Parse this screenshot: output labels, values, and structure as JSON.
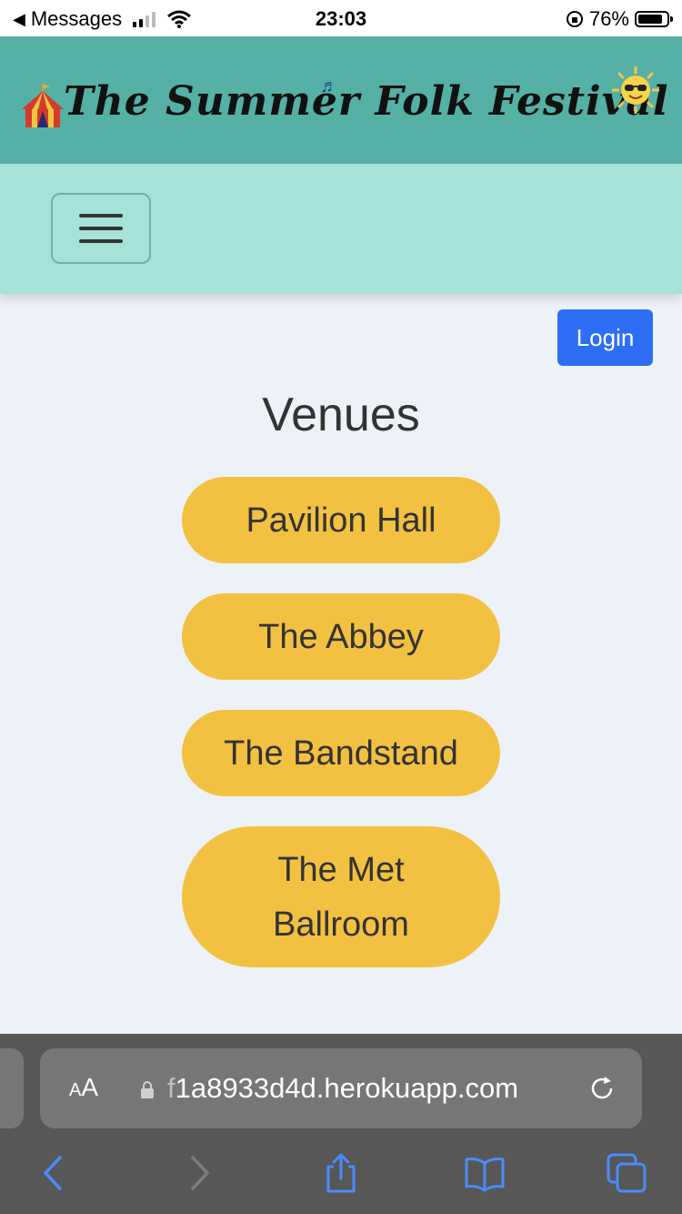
{
  "status_bar": {
    "back_label": "Messages",
    "time": "23:03",
    "battery_percent": "76%",
    "battery_level": 0.76
  },
  "header": {
    "title": "The Summer Folk Festival",
    "icons": [
      "circus-tent-icon",
      "music-note-icon",
      "sun-with-sunglasses-icon"
    ],
    "background_color": "#55b0a6"
  },
  "nav": {
    "menu_icon": "hamburger-menu-icon",
    "background_color": "#a6e2da"
  },
  "auth": {
    "login_label": "Login",
    "login_color": "#2d6ef5"
  },
  "main": {
    "heading": "Venues",
    "venues": [
      {
        "label": "Pavilion Hall"
      },
      {
        "label": "The Abbey"
      },
      {
        "label": "The Bandstand"
      },
      {
        "label": "The Met Ballroom"
      }
    ],
    "venue_button_color": "#f3c141"
  },
  "browser": {
    "text_size_label_small": "A",
    "text_size_label_large": "A",
    "url_prefix": "f",
    "url_rest": "1a8933d4d.herokuapp.com",
    "toolbar_icons": [
      "back-icon",
      "forward-icon",
      "share-icon",
      "bookmarks-icon",
      "tabs-icon"
    ]
  }
}
